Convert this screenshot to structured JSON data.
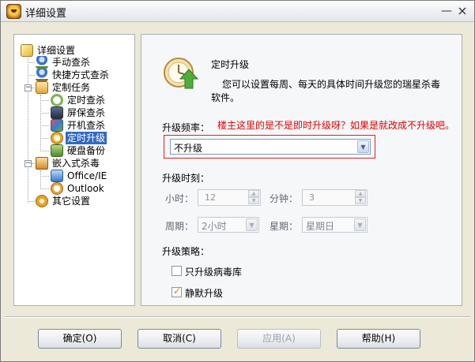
{
  "window": {
    "title": "详细设置"
  },
  "tree": {
    "root": "详细设置",
    "items": [
      {
        "label": "手动查杀",
        "icon": "person-scan-icon"
      },
      {
        "label": "快捷方式查杀",
        "icon": "person-shortcut-icon"
      },
      {
        "label": "定制任务",
        "icon": "scheduled-task-icon",
        "expanded": true
      },
      {
        "label": "定时查杀",
        "icon": "clock-scan-icon"
      },
      {
        "label": "屏保查杀",
        "icon": "screensaver-icon"
      },
      {
        "label": "开机查杀",
        "icon": "boot-scan-icon"
      },
      {
        "label": "定时升级",
        "icon": "timed-upgrade-icon",
        "selected": true
      },
      {
        "label": "硬盘备份",
        "icon": "disk-backup-icon"
      },
      {
        "label": "嵌入式杀毒",
        "icon": "embedded-antivirus-icon",
        "expanded": true
      },
      {
        "label": "Office/IE",
        "icon": "office-ie-icon"
      },
      {
        "label": "Outlook",
        "icon": "outlook-icon"
      },
      {
        "label": "其它设置",
        "icon": "other-settings-icon"
      }
    ]
  },
  "main": {
    "title": "定时升级",
    "description": "您可以设置每周、每天的具体时间升级您的瑞星杀毒软件。",
    "annotation": "楼主这里的是不是即时升级呀？如果是就改成不升级吧。",
    "frequency": {
      "label": "升级频率：",
      "value": "不升级"
    },
    "time": {
      "label": "升级时刻：",
      "hour_label": "小时：",
      "hour_value": "12",
      "minute_label": "分钟：",
      "minute_value": "3",
      "cycle_label": "周期：",
      "cycle_value": "2小时",
      "weekday_label": "星期：",
      "weekday_value": "星期日"
    },
    "strategy": {
      "label": "升级策略：",
      "virus_db_only": {
        "label": "只升级病毒库",
        "checked": false
      },
      "silent": {
        "label": "静默升级",
        "checked": true
      }
    }
  },
  "buttons": {
    "ok": "确定(O)",
    "cancel": "取消(C)",
    "apply": "应用(A)",
    "help": "帮助(H)"
  },
  "colors": {
    "selection": "#316ac5",
    "annotation": "#e00000",
    "frame": "#e02020"
  }
}
